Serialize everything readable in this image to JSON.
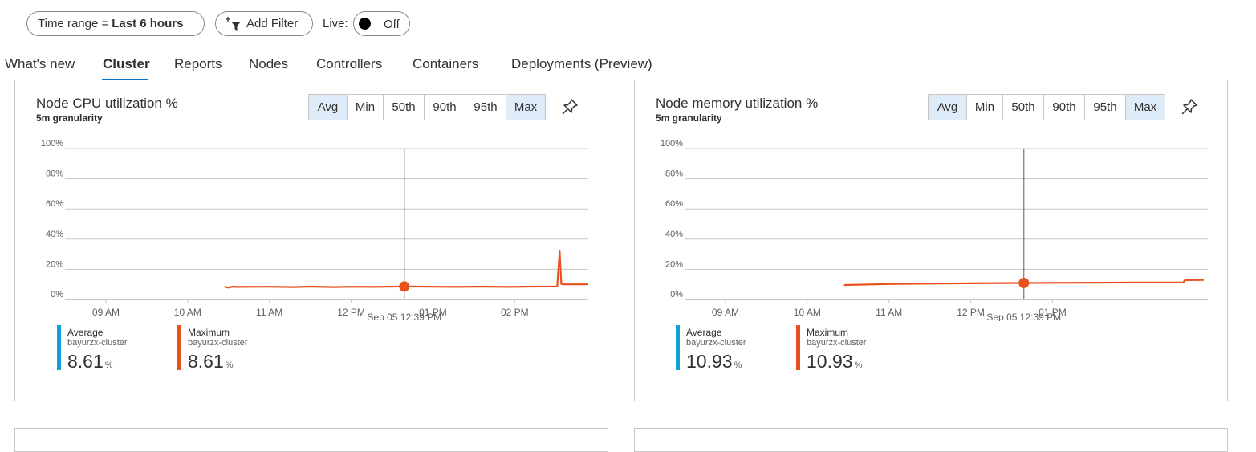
{
  "toolbar": {
    "time_range_label": "Time range =",
    "time_range_value": "Last 6 hours",
    "add_filter_label": "Add Filter",
    "live_label": "Live:",
    "live_state": "Off"
  },
  "tabs": [
    {
      "label": "What's new",
      "active": false
    },
    {
      "label": "Cluster",
      "active": true
    },
    {
      "label": "Reports",
      "active": false
    },
    {
      "label": "Nodes",
      "active": false
    },
    {
      "label": "Controllers",
      "active": false
    },
    {
      "label": "Containers",
      "active": false
    },
    {
      "label": "Deployments (Preview)",
      "active": false
    }
  ],
  "colors": {
    "accent": "#0078d4",
    "average": "#0f9ed5",
    "maximum": "#e8501c",
    "selected_button": "#deecf9"
  },
  "aggregations": [
    {
      "label": "Avg",
      "selected": true
    },
    {
      "label": "Min",
      "selected": false
    },
    {
      "label": "50th",
      "selected": false
    },
    {
      "label": "90th",
      "selected": false
    },
    {
      "label": "95th",
      "selected": false
    },
    {
      "label": "Max",
      "selected": true
    }
  ],
  "panels": [
    {
      "title": "Node CPU utilization %",
      "granularity": "5m granularity",
      "legend": [
        {
          "name": "Average",
          "resource": "bayurzx-cluster",
          "value": "8.61",
          "unit": "%"
        },
        {
          "name": "Maximum",
          "resource": "bayurzx-cluster",
          "value": "8.61",
          "unit": "%"
        }
      ]
    },
    {
      "title": "Node memory utilization %",
      "granularity": "5m granularity",
      "legend": [
        {
          "name": "Average",
          "resource": "bayurzx-cluster",
          "value": "10.93",
          "unit": "%"
        },
        {
          "name": "Maximum",
          "resource": "bayurzx-cluster",
          "value": "10.93",
          "unit": "%"
        }
      ]
    }
  ],
  "chart_data": [
    {
      "type": "line",
      "title": "Node CPU utilization %",
      "y_ticks": [
        "100%",
        "80%",
        "60%",
        "40%",
        "20%",
        "0%"
      ],
      "ylim": [
        0,
        100
      ],
      "x_ticks": [
        "09 AM",
        "10 AM",
        "11 AM",
        "12 PM",
        "01 PM",
        "02 PM"
      ],
      "x_tick_hours": [
        9,
        10,
        11,
        12,
        13,
        14
      ],
      "xlim_hours": [
        8.5,
        14.9
      ],
      "cursor_label": "Sep 05 12:39 PM",
      "cursor_hour": 12.65,
      "cursor_value": 8.61,
      "series": [
        {
          "name": "Maximum",
          "color": "#e8501c",
          "x_hours": [
            10.45,
            10.5,
            10.55,
            10.6,
            11.0,
            11.3,
            11.5,
            11.8,
            12.0,
            12.3,
            12.65,
            13.0,
            13.3,
            13.6,
            13.9,
            14.2,
            14.52,
            14.55,
            14.57,
            14.6,
            14.9
          ],
          "values": [
            8.4,
            7.8,
            8.5,
            8.3,
            8.4,
            8.2,
            8.5,
            8.2,
            8.4,
            8.3,
            8.61,
            8.4,
            8.3,
            8.5,
            8.3,
            8.5,
            8.6,
            32.0,
            10.2,
            10.0,
            10.0
          ]
        }
      ]
    },
    {
      "type": "line",
      "title": "Node memory utilization %",
      "y_ticks": [
        "100%",
        "80%",
        "60%",
        "40%",
        "20%",
        "0%"
      ],
      "ylim": [
        0,
        100
      ],
      "x_ticks": [
        "09 AM",
        "10 AM",
        "11 AM",
        "12 PM",
        "01 PM"
      ],
      "x_tick_hours": [
        9,
        10,
        11,
        12,
        13
      ],
      "xlim_hours": [
        8.5,
        14.9
      ],
      "cursor_label": "Sep 05 12:39 PM",
      "cursor_hour": 12.65,
      "cursor_value": 10.93,
      "series": [
        {
          "name": "Maximum",
          "color": "#e8501c",
          "x_hours": [
            10.45,
            11.0,
            11.5,
            12.0,
            12.65,
            13.0,
            13.5,
            14.0,
            14.6,
            14.62,
            14.85
          ],
          "values": [
            9.6,
            10.2,
            10.5,
            10.7,
            10.93,
            11.0,
            11.1,
            11.2,
            11.3,
            12.8,
            12.9
          ]
        }
      ]
    }
  ]
}
